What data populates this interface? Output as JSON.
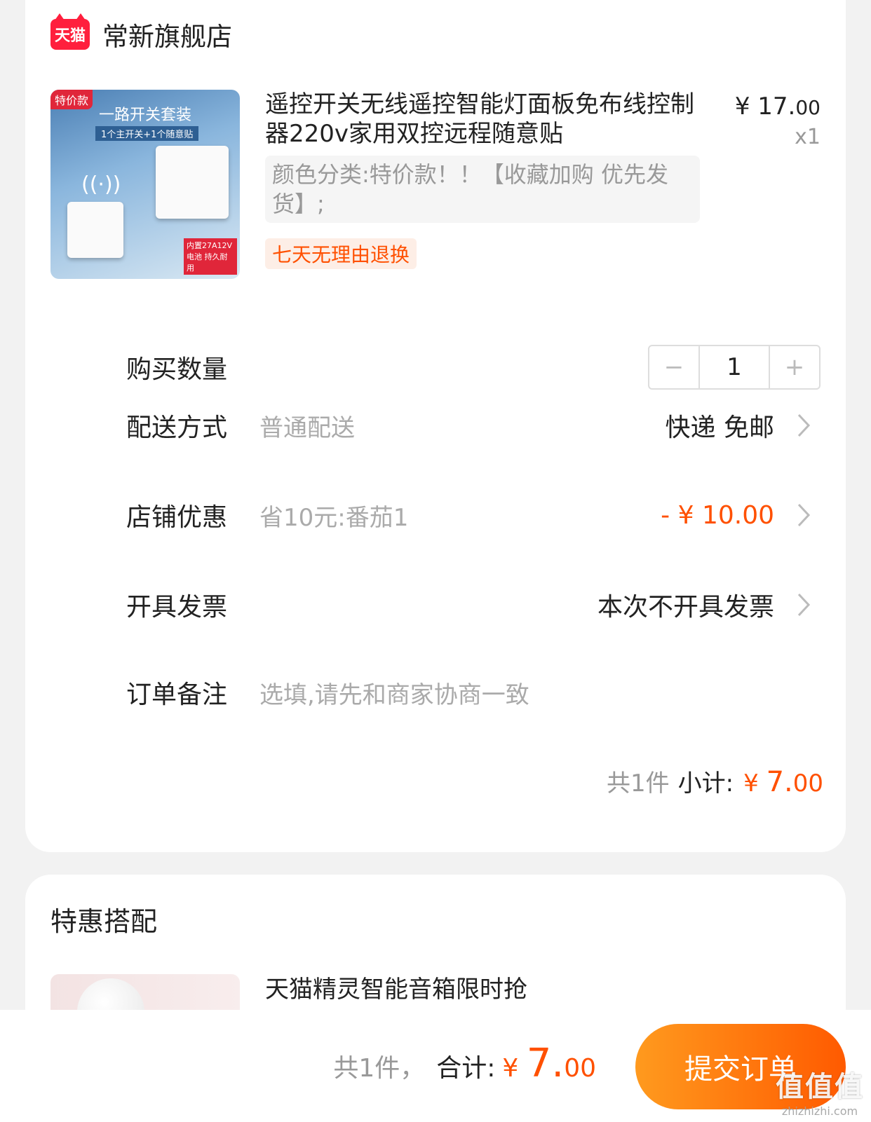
{
  "shop": {
    "badge": "天猫",
    "name": "常新旗舰店"
  },
  "product": {
    "thumb_tag": "特价款",
    "thumb_title": "一路开关套装",
    "thumb_subtitle": "1个主开关+1个随意贴",
    "thumb_battery": "内置27A12V电池 持久耐用",
    "title": "遥控开关无线遥控智能灯面板免布线控制器220v家用双控远程随意贴",
    "price_main": "¥ 17.",
    "price_cents": "00",
    "quantity": "x1",
    "sku": "颜色分类:特价款！！【收藏加购 优先发货】;",
    "return_tag": "七天无理由退换"
  },
  "rows": {
    "quantity": {
      "label": "购买数量",
      "minus": "−",
      "value": "1",
      "plus": "+"
    },
    "delivery": {
      "label": "配送方式",
      "hint": "普通配送",
      "value": "快递 免邮"
    },
    "discount": {
      "label": "店铺优惠",
      "hint": "省10元:番茄1",
      "value": "- ¥ 10.00"
    },
    "invoice": {
      "label": "开具发票",
      "value": "本次不开具发票"
    },
    "note": {
      "label": "订单备注",
      "placeholder": "选填,请先和商家协商一致"
    }
  },
  "subtotal": {
    "count": "共1件",
    "label": "小计:",
    "currency": "¥ ",
    "main": "7.",
    "cents": "00"
  },
  "combo": {
    "title": "特惠搭配",
    "item_name": "天猫精灵智能音箱限时抢"
  },
  "footer": {
    "count": "共1件，",
    "label": "合计:",
    "currency": "¥ ",
    "main": "7.",
    "cents": "00",
    "submit": "提交订单",
    "watermark": "值值值",
    "watermark_url": "zhizhizhi.com"
  },
  "colors": {
    "accent": "#ff5000",
    "tmall_red": "#ff1f3d"
  }
}
